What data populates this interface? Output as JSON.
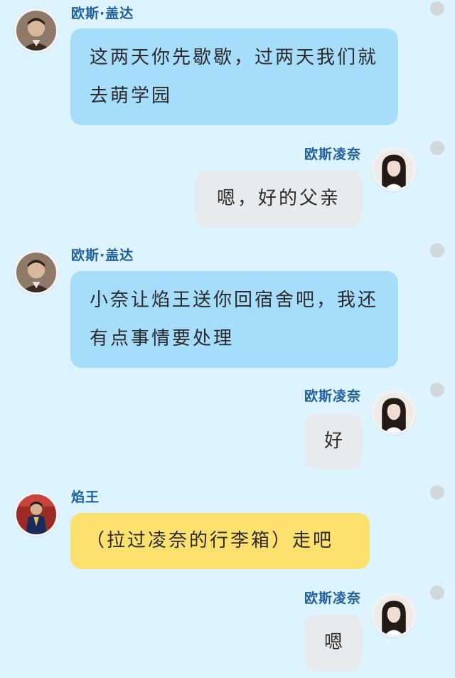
{
  "messages": [
    {
      "speaker": "欧斯·盖达",
      "text": "这两天你先歇歇，过两天我们就去萌学园"
    },
    {
      "speaker": "欧斯凌奈",
      "text": "嗯，好的父亲"
    },
    {
      "speaker": "欧斯·盖达",
      "text": "小奈让焰王送你回宿舍吧，我还有点事情要处理"
    },
    {
      "speaker": "欧斯凌奈",
      "text": "好"
    },
    {
      "speaker": "焰王",
      "text": "（拉过凌奈的行李箱）走吧"
    },
    {
      "speaker": "欧斯凌奈",
      "text": "嗯"
    }
  ],
  "colors": {
    "background": "#ddf3fd",
    "name": "#1f5f9f",
    "bubble_father": "#a6ddfb",
    "bubble_self": "#e8ebee",
    "bubble_yanwang": "#fde16f"
  },
  "icons": {
    "father_avatar": "avatar-father",
    "self_avatar": "avatar-girl",
    "yanwang_avatar": "avatar-yanwang",
    "binder_holes": "binder-hole"
  }
}
